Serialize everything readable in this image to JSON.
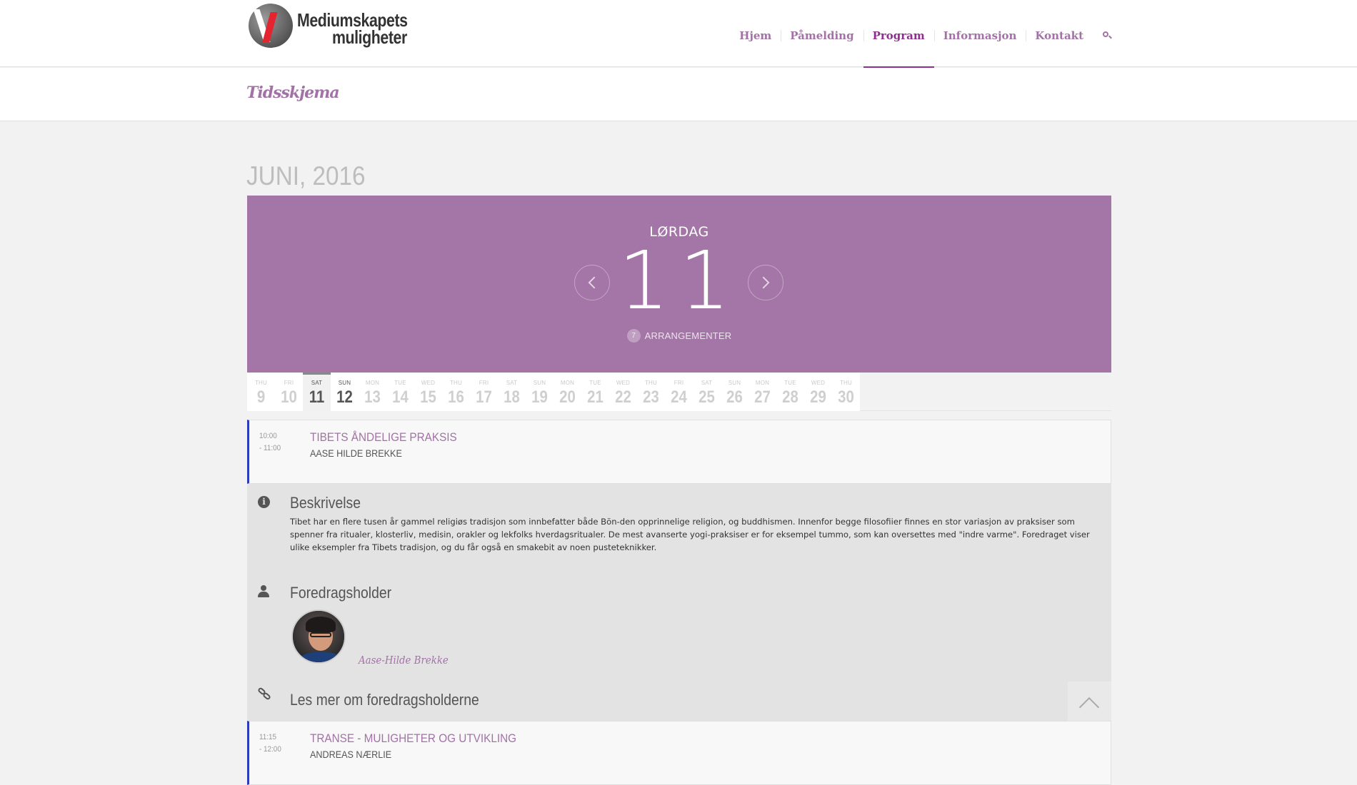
{
  "header": {
    "logo_line1": "Mediumskapets",
    "logo_line2": "muligheter",
    "nav": [
      "Hjem",
      "Påmelding",
      "Program",
      "Informasjon",
      "Kontakt"
    ],
    "active_nav": "Program",
    "search_icon": "search-icon"
  },
  "page": {
    "title": "Tidsskjema"
  },
  "calendar": {
    "month": "JUNI, 2016",
    "weekday": "LØRDAG",
    "day": "11",
    "event_count": "7",
    "events_label": "ARRANGEMENTER",
    "days": [
      {
        "wd": "THU",
        "d": "9"
      },
      {
        "wd": "FRI",
        "d": "10"
      },
      {
        "wd": "SAT",
        "d": "11"
      },
      {
        "wd": "SUN",
        "d": "12"
      },
      {
        "wd": "MON",
        "d": "13"
      },
      {
        "wd": "TUE",
        "d": "14"
      },
      {
        "wd": "WED",
        "d": "15"
      },
      {
        "wd": "THU",
        "d": "16"
      },
      {
        "wd": "FRI",
        "d": "17"
      },
      {
        "wd": "SAT",
        "d": "18"
      },
      {
        "wd": "SUN",
        "d": "19"
      },
      {
        "wd": "MON",
        "d": "20"
      },
      {
        "wd": "TUE",
        "d": "21"
      },
      {
        "wd": "WED",
        "d": "22"
      },
      {
        "wd": "THU",
        "d": "23"
      },
      {
        "wd": "FRI",
        "d": "24"
      },
      {
        "wd": "SAT",
        "d": "25"
      },
      {
        "wd": "SUN",
        "d": "26"
      },
      {
        "wd": "MON",
        "d": "27"
      },
      {
        "wd": "TUE",
        "d": "28"
      },
      {
        "wd": "WED",
        "d": "29"
      },
      {
        "wd": "THU",
        "d": "30"
      }
    ]
  },
  "events": [
    {
      "time_start": "10:00",
      "time_end": "- 11:00",
      "title": "TIBETS ÅNDELIGE PRAKSIS",
      "speaker": "AASE HILDE BREKKE"
    },
    {
      "time_start": "11:15",
      "time_end": "- 12:00",
      "title": "TRANSE - MULIGHETER OG UTVIKLING",
      "speaker": "ANDREAS NÆRLIE"
    }
  ],
  "details": {
    "desc_heading": "Beskrivelse",
    "description": "Tibet har en flere tusen år gammel religiøs tradisjon som innbefatter både Bön-den opprinnelige religion, og buddhismen. Innenfor begge filosofiier finnes en stor variasjon av praksiser som spenner fra ritualer, klosterliv, medisin, orakler og lekfolks hverdagsritualer. De mest avanserte yogi-praksiser er for eksempel tummo, som kan oversettes med \"indre varme\". Foredraget viser ulike eksempler fra Tibets tradisjon, og du får også en smakebit av noen pusteteknikker.",
    "speaker_heading": "Foredragsholder",
    "speaker_name": "Aase-Hilde Brekke",
    "more_heading": "Les mer om foredragsholderne"
  }
}
